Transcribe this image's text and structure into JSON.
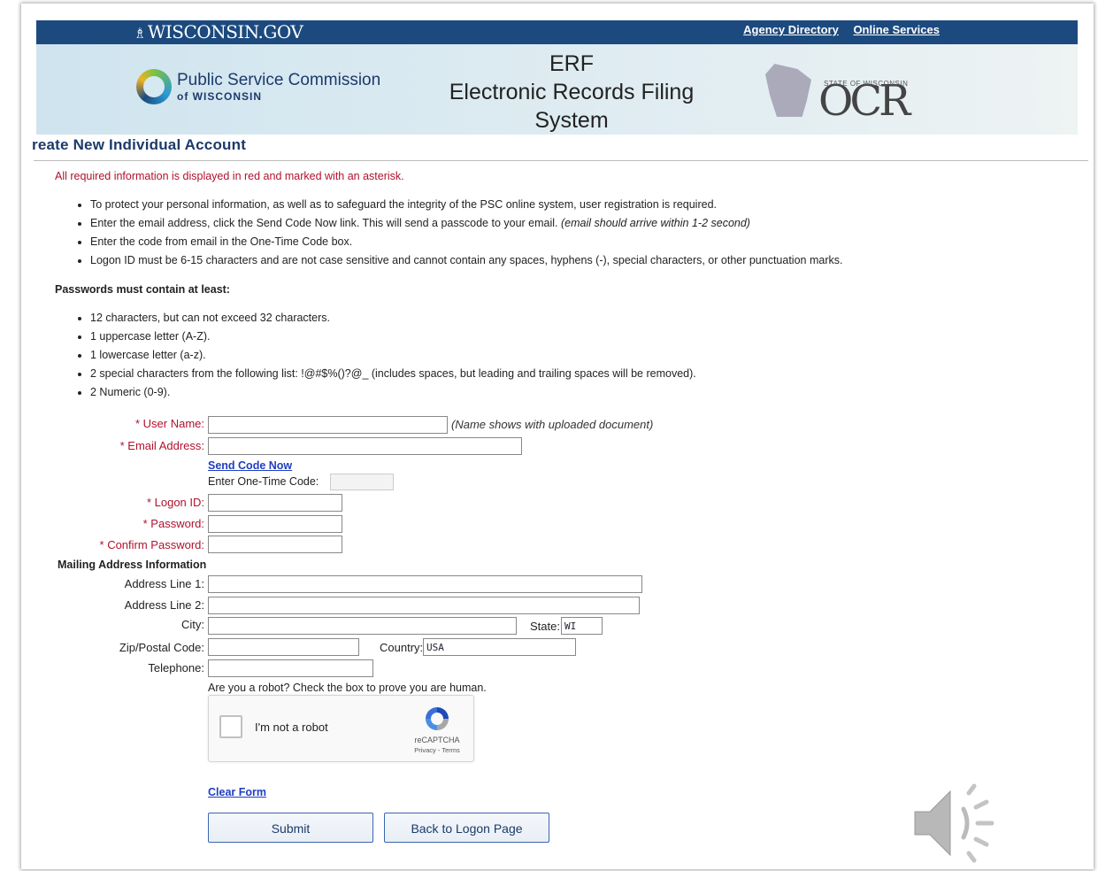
{
  "header": {
    "brand": "WISCONSIN.GOV",
    "links": [
      "Agency Directory",
      "Online Services"
    ]
  },
  "banner": {
    "psc_line1": "Public Service Commission",
    "psc_line2": "of WISCONSIN",
    "title_line1": "ERF",
    "title_line2": "Electronic Records Filing",
    "title_line3": "System",
    "ocr_state": "STATE OF WISCONSIN",
    "ocr_text": "OCR"
  },
  "page": {
    "title": "reate New Individual Account",
    "required_note": "All required information is displayed in red and marked with an asterisk.",
    "info_items": [
      "To protect your personal information, as well as to safeguard the integrity of the PSC online system, user registration is required.",
      "Enter the email address, click the Send Code Now link. This will send a passcode to your email.",
      "(email should arrive within 1-2 second)",
      "Enter the code from email in the One-Time Code box.",
      "Logon ID must be 6-15 characters and are not case sensitive and cannot contain any spaces, hyphens (-), special characters, or other punctuation marks."
    ],
    "password_heading": "Passwords must contain at least:",
    "password_items": [
      "12 characters, but can not exceed 32 characters.",
      "1 uppercase letter (A-Z).",
      "1 lowercase letter (a-z).",
      "2 special characters from the following list: !@#$%()?@_ (includes spaces, but leading and trailing spaces will be removed).",
      "2 Numeric (0-9)."
    ]
  },
  "form": {
    "star": "*",
    "user_name_label": "User Name:",
    "user_name_note": "(Name shows with uploaded document)",
    "email_label": "Email Address:",
    "send_code": "Send Code Now",
    "otc_label": "Enter One-Time Code:",
    "logon_label": "Logon ID:",
    "password_label": "Password:",
    "confirm_label": "Confirm Password:",
    "mailing_heading": "Mailing Address Information",
    "addr1_label": "Address Line 1:",
    "addr2_label": "Address Line 2:",
    "city_label": "City:",
    "state_label": "State:",
    "state_value": "WI",
    "zip_label": "Zip/Postal Code:",
    "country_label": "Country:",
    "country_value": "USA",
    "phone_label": "Telephone:",
    "robot_prompt": "Are you a robot? Check the box to prove you are human.",
    "captcha_label": "I'm not a robot",
    "captcha_brand": "reCAPTCHA",
    "captcha_terms": "Privacy - Terms",
    "clear_form": "Clear Form",
    "submit": "Submit",
    "back": "Back to Logon Page"
  }
}
